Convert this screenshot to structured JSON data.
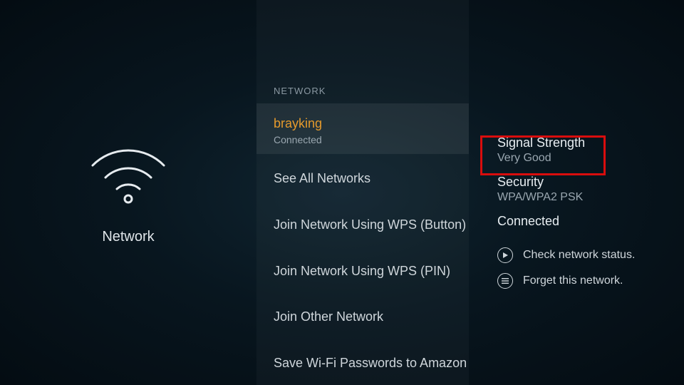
{
  "left": {
    "title": "Network"
  },
  "mid": {
    "header": "NETWORK",
    "items": [
      {
        "title": "brayking",
        "sub": "Connected",
        "selected": true
      },
      {
        "title": "See All Networks"
      },
      {
        "title": "Join Network Using WPS (Button)"
      },
      {
        "title": "Join Network Using WPS (PIN)"
      },
      {
        "title": "Join Other Network"
      },
      {
        "title": "Save Wi-Fi Passwords to Amazon"
      }
    ]
  },
  "right": {
    "signal_label": "Signal Strength",
    "signal_value": "Very Good",
    "security_label": "Security",
    "security_value": "WPA/WPA2 PSK",
    "status": "Connected",
    "actions": [
      {
        "icon": "play",
        "label": "Check network status."
      },
      {
        "icon": "menu",
        "label": "Forget this network."
      }
    ]
  }
}
